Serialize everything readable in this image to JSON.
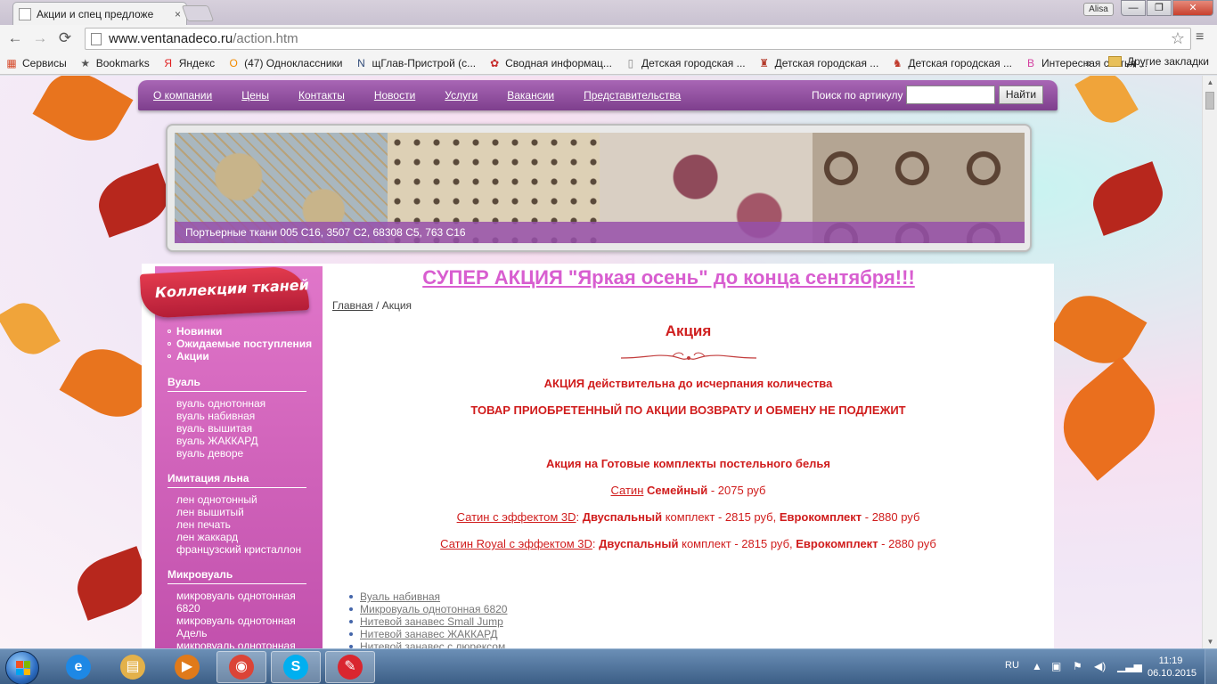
{
  "browser": {
    "tab_title": "Акции и спец предложе",
    "tab_close": "×",
    "user_name": "Alisa",
    "min_label": "—",
    "max_label": "❐",
    "close_label": "✕",
    "url_host": "www.ventanadeco.ru",
    "url_path": "/action.htm",
    "back_glyph": "←",
    "forward_glyph": "→",
    "reload_glyph": "⟳",
    "star_glyph": "☆",
    "menu_glyph": "≡",
    "bookmarks": [
      {
        "label": "Сервисы",
        "icon": "apps-grid-icon",
        "glyph": "▦",
        "color": "#d54a2b"
      },
      {
        "label": "Bookmarks",
        "icon": "star-icon",
        "glyph": "★",
        "color": "#555555"
      },
      {
        "label": "Яндекс",
        "icon": "yandex-icon",
        "glyph": "Я",
        "color": "#e02020"
      },
      {
        "label": "(47) Одноклассники",
        "icon": "odnoklassniki-icon",
        "glyph": "О",
        "color": "#f28a00"
      },
      {
        "label": "щГлав-Пристрой (с...",
        "icon": "nn-icon",
        "glyph": "N",
        "color": "#2f4a78"
      },
      {
        "label": "Сводная информац...",
        "icon": "flower-icon",
        "glyph": "✿",
        "color": "#c62828"
      },
      {
        "label": "Детская городская ...",
        "icon": "page-icon",
        "glyph": "▯",
        "color": "#888888"
      },
      {
        "label": "Детская городская ...",
        "icon": "emblem-icon",
        "glyph": "♜",
        "color": "#b33a2a"
      },
      {
        "label": "Детская городская ...",
        "icon": "deer-icon",
        "glyph": "♞",
        "color": "#c0392b"
      },
      {
        "label": "Интересная статья ...",
        "icon": "b-icon",
        "glyph": "B",
        "color": "#d43fa0"
      }
    ],
    "bookmarks_overflow": "»",
    "other_bookmarks": "Другие закладки"
  },
  "site": {
    "nav": [
      "О компании",
      "Цены",
      "Контакты",
      "Новости",
      "Услуги",
      "Вакансии",
      "Представительства"
    ],
    "search_label": "Поиск по артикулу",
    "search_value": "",
    "search_button": "Найти",
    "banner_caption": "Портьерные ткани 005 C16, 3507 C2, 68308 C5, 763 C16"
  },
  "sidebar": {
    "ribbon": "Коллекции тканей",
    "top_items": [
      "Новинки",
      "Ожидаемые поступления",
      "Акции"
    ],
    "sections": [
      {
        "heading": "Вуаль",
        "items": [
          "вуаль однотонная",
          "вуаль набивная",
          "вуаль вышитая",
          "вуаль ЖАККАРД",
          "вуаль деворе"
        ]
      },
      {
        "heading": "Имитация льна",
        "items": [
          "лен однотонный",
          "лен вышитый",
          "лен печать",
          "лен жаккард",
          "французский кристаллон"
        ]
      },
      {
        "heading": "Микровуаль",
        "items": [
          "микровуаль однотонная",
          "6820",
          "микровуаль однотонная",
          "Адель",
          "микровуаль однотонная"
        ]
      }
    ]
  },
  "main": {
    "promo_title": "СУПЕР АКЦИЯ \"Яркая осень\" до конца сентября!!!",
    "crumb_home": "Главная",
    "crumb_sep": " / ",
    "crumb_current": "Акция",
    "heading": "Акция",
    "notice_1": "АКЦИЯ действительна до исчерпания количества",
    "notice_2": "ТОВАР ПРИОБРЕТЕННЫЙ ПО АКЦИИ ВОЗВРАТУ И ОБМЕНУ НЕ ПОДЛЕЖИТ",
    "offer_title": "Акция на Готовые комплекты постельного белья",
    "offers": [
      {
        "link": "Сатин",
        "bold1": "Семейный",
        "text1": " - 2075 руб",
        "bold2": "",
        "text2": ""
      },
      {
        "link": "Сатин с эффектом 3D",
        "sep": ": ",
        "bold1": "Двуспальный",
        "text1": " комплект - 2815 руб, ",
        "bold2": "Еврокомплект",
        "text2": " - 2880 руб"
      },
      {
        "link": "Сатин Royal с эффектом 3D",
        "sep": ": ",
        "bold1": "Двуспальный",
        "text1": " комплект - 2815 руб, ",
        "bold2": "Еврокомплект",
        "text2": " - 2880 руб"
      }
    ],
    "goods": [
      "Вуаль набивная",
      "Микровуаль однотонная 6820",
      "Нитевой занавес Small Jump",
      "Нитевой занавес ЖАККАРД",
      "Нитевой занавес с люрексом"
    ]
  },
  "taskbar": {
    "lang": "RU",
    "time": "11:19",
    "date": "06.10.2015",
    "tray_up": "▲",
    "apps": [
      {
        "name": "ie-icon",
        "glyph": "e",
        "color": "#1e88e5",
        "active": false
      },
      {
        "name": "explorer-icon",
        "glyph": "▤",
        "color": "#e3b14a",
        "active": false
      },
      {
        "name": "media-player-icon",
        "glyph": "▶",
        "color": "#e07a1a",
        "active": false
      },
      {
        "name": "chrome-icon",
        "glyph": "◉",
        "color": "#db4437",
        "active": true
      },
      {
        "name": "skype-icon",
        "glyph": "S",
        "color": "#00aff0",
        "active": true
      },
      {
        "name": "photo-app-icon",
        "glyph": "✎",
        "color": "#d9262f",
        "active": true
      }
    ]
  }
}
